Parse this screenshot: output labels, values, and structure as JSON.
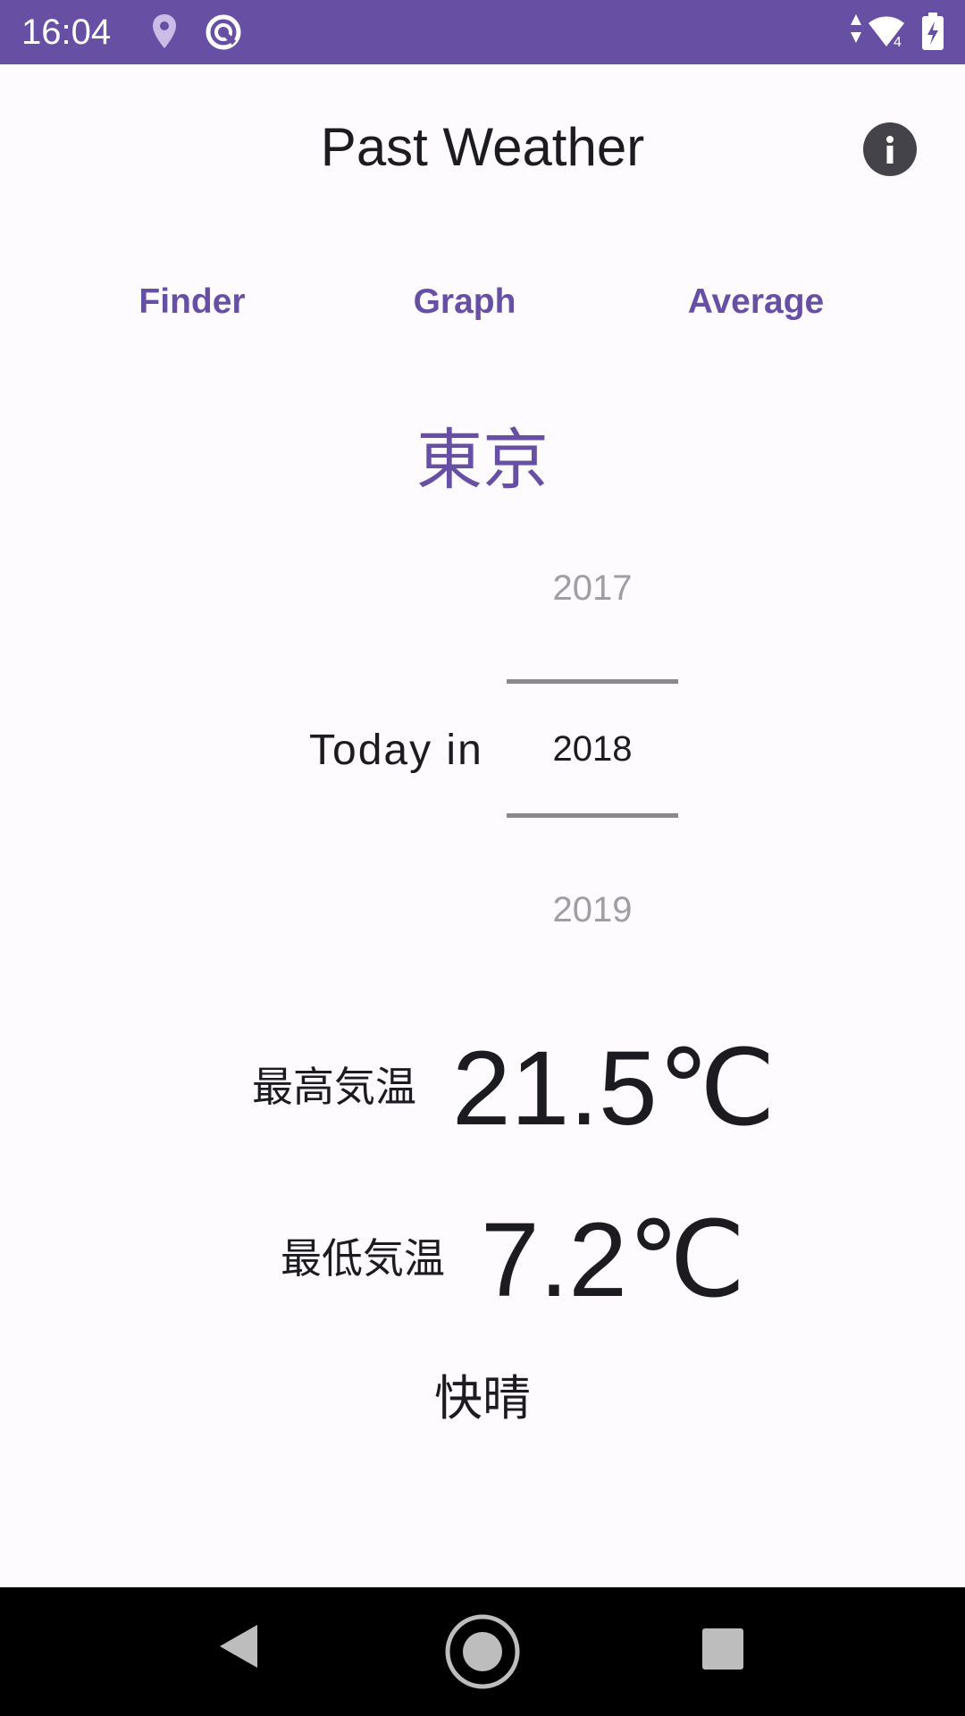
{
  "status_bar": {
    "time": "16:04",
    "icons": [
      "location-pin-icon",
      "sync-icon",
      "data-arrows-icon",
      "wifi-icon",
      "battery-charging-icon"
    ]
  },
  "app": {
    "title": "Past Weather",
    "info_icon": "info-icon"
  },
  "tabs": [
    {
      "label": "Finder"
    },
    {
      "label": "Graph"
    },
    {
      "label": "Average"
    }
  ],
  "city": "東京",
  "year_picker": {
    "prefix": "Today in",
    "previous": "2017",
    "selected": "2018",
    "next": "2019"
  },
  "weather": {
    "max_label": "最高気温",
    "max_value": "21.5℃",
    "min_label": "最低気温",
    "min_value": "7.2℃",
    "condition": "快晴"
  },
  "colors": {
    "accent": "#6750a4",
    "background": "#fefbff",
    "text": "#1c1b1f",
    "faded_text": "#a09ea3"
  },
  "nav_bar": {
    "icons": [
      "back-icon",
      "home-icon",
      "recents-icon"
    ]
  }
}
